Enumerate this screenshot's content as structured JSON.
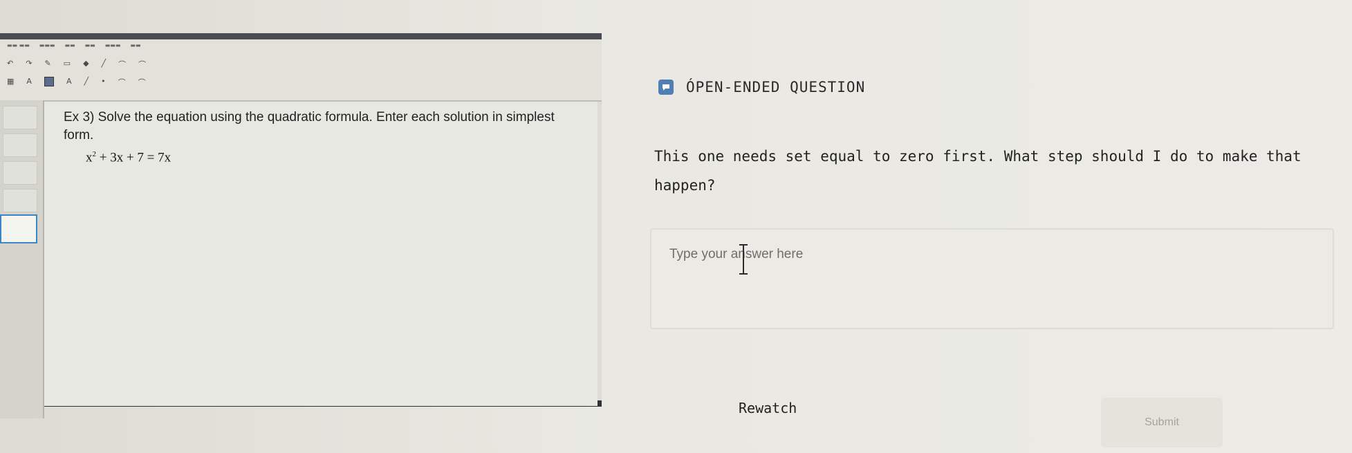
{
  "video": {
    "question_text": "Ex 3) Solve the equation using the quadratic formula. Enter each solution in simplest form.",
    "equation_lhs": "x",
    "equation_exp": "2",
    "equation_rest": " + 3x + 7 = 7x"
  },
  "open_ended": {
    "icon": "chat-bubble-icon",
    "title": "ÓPEN-ENDED QUESTION",
    "question": "This one needs set equal to zero first. What step should I do to make that happen?",
    "answer_placeholder": "Type your answer here",
    "answer_value": ""
  },
  "actions": {
    "rewatch_label": "Rewatch",
    "submit_label": "Submit"
  },
  "colors": {
    "accent": "#4f7fb3",
    "video_frame": "#2f3135",
    "background": "#e9e8e1"
  }
}
